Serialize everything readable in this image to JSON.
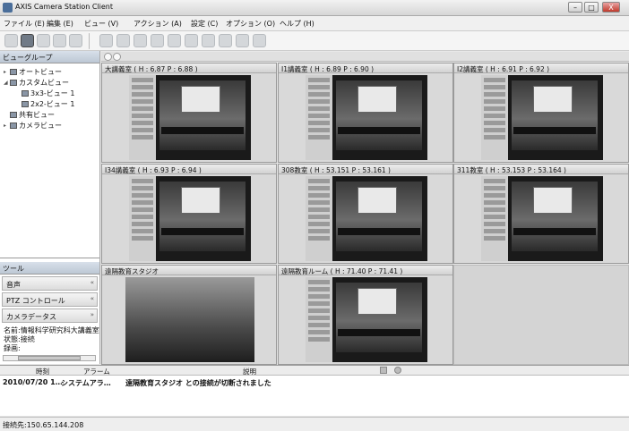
{
  "window": {
    "title": "AXIS Camera Station Client",
    "min": "–",
    "max": "□",
    "close": "X"
  },
  "menu": [
    "ファイル (E)",
    "編集 (E)",
    "ビュー (V)",
    "アクション (A)",
    "設定 (C)",
    "オプション (O)",
    "ヘルプ (H)"
  ],
  "toolbar_icons": [
    "live-view-icon",
    "playback-icon",
    "search-icon",
    "export-icon",
    "config-icon"
  ],
  "left_panel": {
    "view_group_title": "ビューグループ",
    "tree": [
      {
        "label": "オートビュー",
        "expanded": false
      },
      {
        "label": "カスタムビュー",
        "expanded": true
      },
      {
        "label": "3x3-ビュー 1"
      },
      {
        "label": "2x2-ビュー 1"
      },
      {
        "label": "共有ビュー"
      },
      {
        "label": "カメラビュー",
        "expanded": false
      }
    ],
    "tools_title": "ツール",
    "tools": [
      "音声",
      "PTZ コントロール",
      "カメラデータス"
    ],
    "camera_data": [
      "名前:情報科学研究科大講義室",
      "状態:接続",
      "録画:"
    ],
    "scroll_label": "III"
  },
  "cameras": [
    {
      "title": "大講義室 ( H : 6.87  P : 6.88 )"
    },
    {
      "title": "I1講義室 ( H : 6.89  P : 6.90 )"
    },
    {
      "title": "I2講義室 ( H : 6.91  P : 6.92 )"
    },
    {
      "title": "I34講義室 ( H : 6.93  P : 6.94 )"
    },
    {
      "title": "308教室 ( H : 53.151  P : 53.161 )"
    },
    {
      "title": "311教室 ( H : 53.153  P : 53.164 )"
    },
    {
      "title": "遠隔教育スタジオ"
    },
    {
      "title": "遠隔教育ルーム ( H : 71.40  P : 71.41 )"
    }
  ],
  "log": {
    "columns": [
      "時刻",
      "アラーム",
      "説明"
    ],
    "rows": [
      {
        "time": "2010/07/20 1…",
        "alarm": "システムアラ…",
        "desc": "遠隔教育スタジオ との接続が切断されました"
      }
    ]
  },
  "status_bar": "接続先:150.65.144.208"
}
